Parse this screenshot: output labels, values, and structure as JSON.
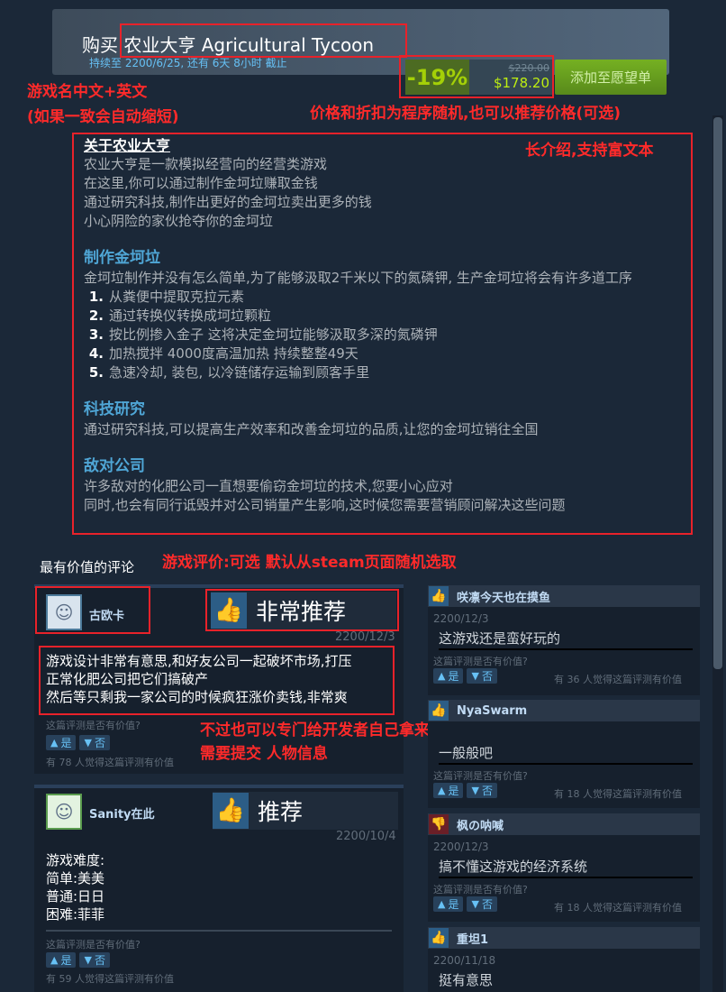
{
  "purchase": {
    "title": "购买 农业大亨 Agricultural Tycoon",
    "subtitle": "持续至 2200/6/25, 还有 6天 8小时 截止",
    "discount": "-19%",
    "original_price": "$220.00",
    "final_price": "$178.20",
    "wishlist_label": "添加至愿望单"
  },
  "annotations": {
    "name": "游戏名中文+英文",
    "name_sub": "(如果一致会自动缩短)",
    "price": "价格和折扣为程序随机,也可以推荐价格(可选)",
    "long_desc": "长介绍,支持富文本",
    "reviews": "游戏评价:可选 默认从steam页面随机选取",
    "dev_review": "不过也可以专门给开发者自己拿来整活",
    "dev_review_sub": "需要提交 人物信息"
  },
  "description": {
    "title": "关于农业大亨",
    "intro": [
      "农业大亨是一款模拟经营向的经营类游戏",
      "在这里,你可以通过制作金坷垃赚取金钱",
      "通过研究科技,制作出更好的金坷垃卖出更多的钱",
      "小心阴险的家伙抢夺你的金坷垃"
    ],
    "s1_title": "制作金坷垃",
    "s1_text": "金坷垃制作并没有怎么简单,为了能够汲取2千米以下的氮磷钾, 生产金坷垃将会有许多道工序",
    "steps": [
      {
        "num": "1.",
        "text": "从粪便中提取克拉元素"
      },
      {
        "num": "2.",
        "text": "通过转换仪转换成坷垃颗粒"
      },
      {
        "num": "3.",
        "text": "按比例掺入金子 这将决定金坷垃能够汲取多深的氮磷钾"
      },
      {
        "num": "4.",
        "text": "加热搅拌 4000度高温加热 持续整整49天"
      },
      {
        "num": "5.",
        "text": "急速冷却, 装包, 以冷链储存运输到顾客手里"
      }
    ],
    "s2_title": "科技研究",
    "s2_text": "通过研究科技,可以提高生产效率和改善金坷垃的品质,让您的金坷垃销往全国",
    "s3_title": "敌对公司",
    "s3_lines": [
      "许多敌对的化肥公司一直想要偷窃金坷垃的技术,您要小心应对",
      "同时,也会有同行诋毁并对公司销量产生影响,这时候您需要营销顾问解决这些问题"
    ]
  },
  "reviews_heading": "最有价值的评论",
  "common": {
    "helpful_q": "这篇评测是否有价值?",
    "yes": "是",
    "no": "否"
  },
  "left_reviews": [
    {
      "user": "古欧卡",
      "verdict": "非常推荐",
      "date": "2200/12/3",
      "lines": [
        "游戏设计非常有意思,和好友公司一起破坏市场,打压",
        "正常化肥公司把它们搞破产",
        "然后等只剩我一家公司的时候疯狂涨价卖钱,非常爽"
      ],
      "found": "有 78 人觉得这篇评测有价值"
    },
    {
      "user": "Sanity在此",
      "verdict": "推荐",
      "date": "2200/10/4",
      "lines": [
        "游戏难度:",
        "简单:美美",
        "普通:日日",
        "困难:菲菲"
      ],
      "found": "有 59 人觉得这篇评测有价值"
    }
  ],
  "right_reviews": [
    {
      "user": "咲凛今天也在摸鱼",
      "date": "2200/12/3",
      "text": "这游戏还是蛮好玩的",
      "found": "有 36 人觉得这篇评测有价值",
      "positive": true
    },
    {
      "user": "NyaSwarm",
      "date": "",
      "text": "一般般吧",
      "found": "有 18 人觉得这篇评测有价值",
      "positive": true
    },
    {
      "user": "枫の呐喊",
      "date": "2200/12/3",
      "text": "搞不懂这游戏的经济系统",
      "found": "有 18 人觉得这篇评测有价值",
      "positive": false
    },
    {
      "user": "重坦1",
      "date": "2200/11/18",
      "text": "挺有意思",
      "found": "",
      "positive": true
    }
  ],
  "colors": {
    "page_bg": "#1b2838",
    "accent_blue": "#66c0f4",
    "discount_green": "#a4d007",
    "annotation_red": "#e8222a"
  }
}
